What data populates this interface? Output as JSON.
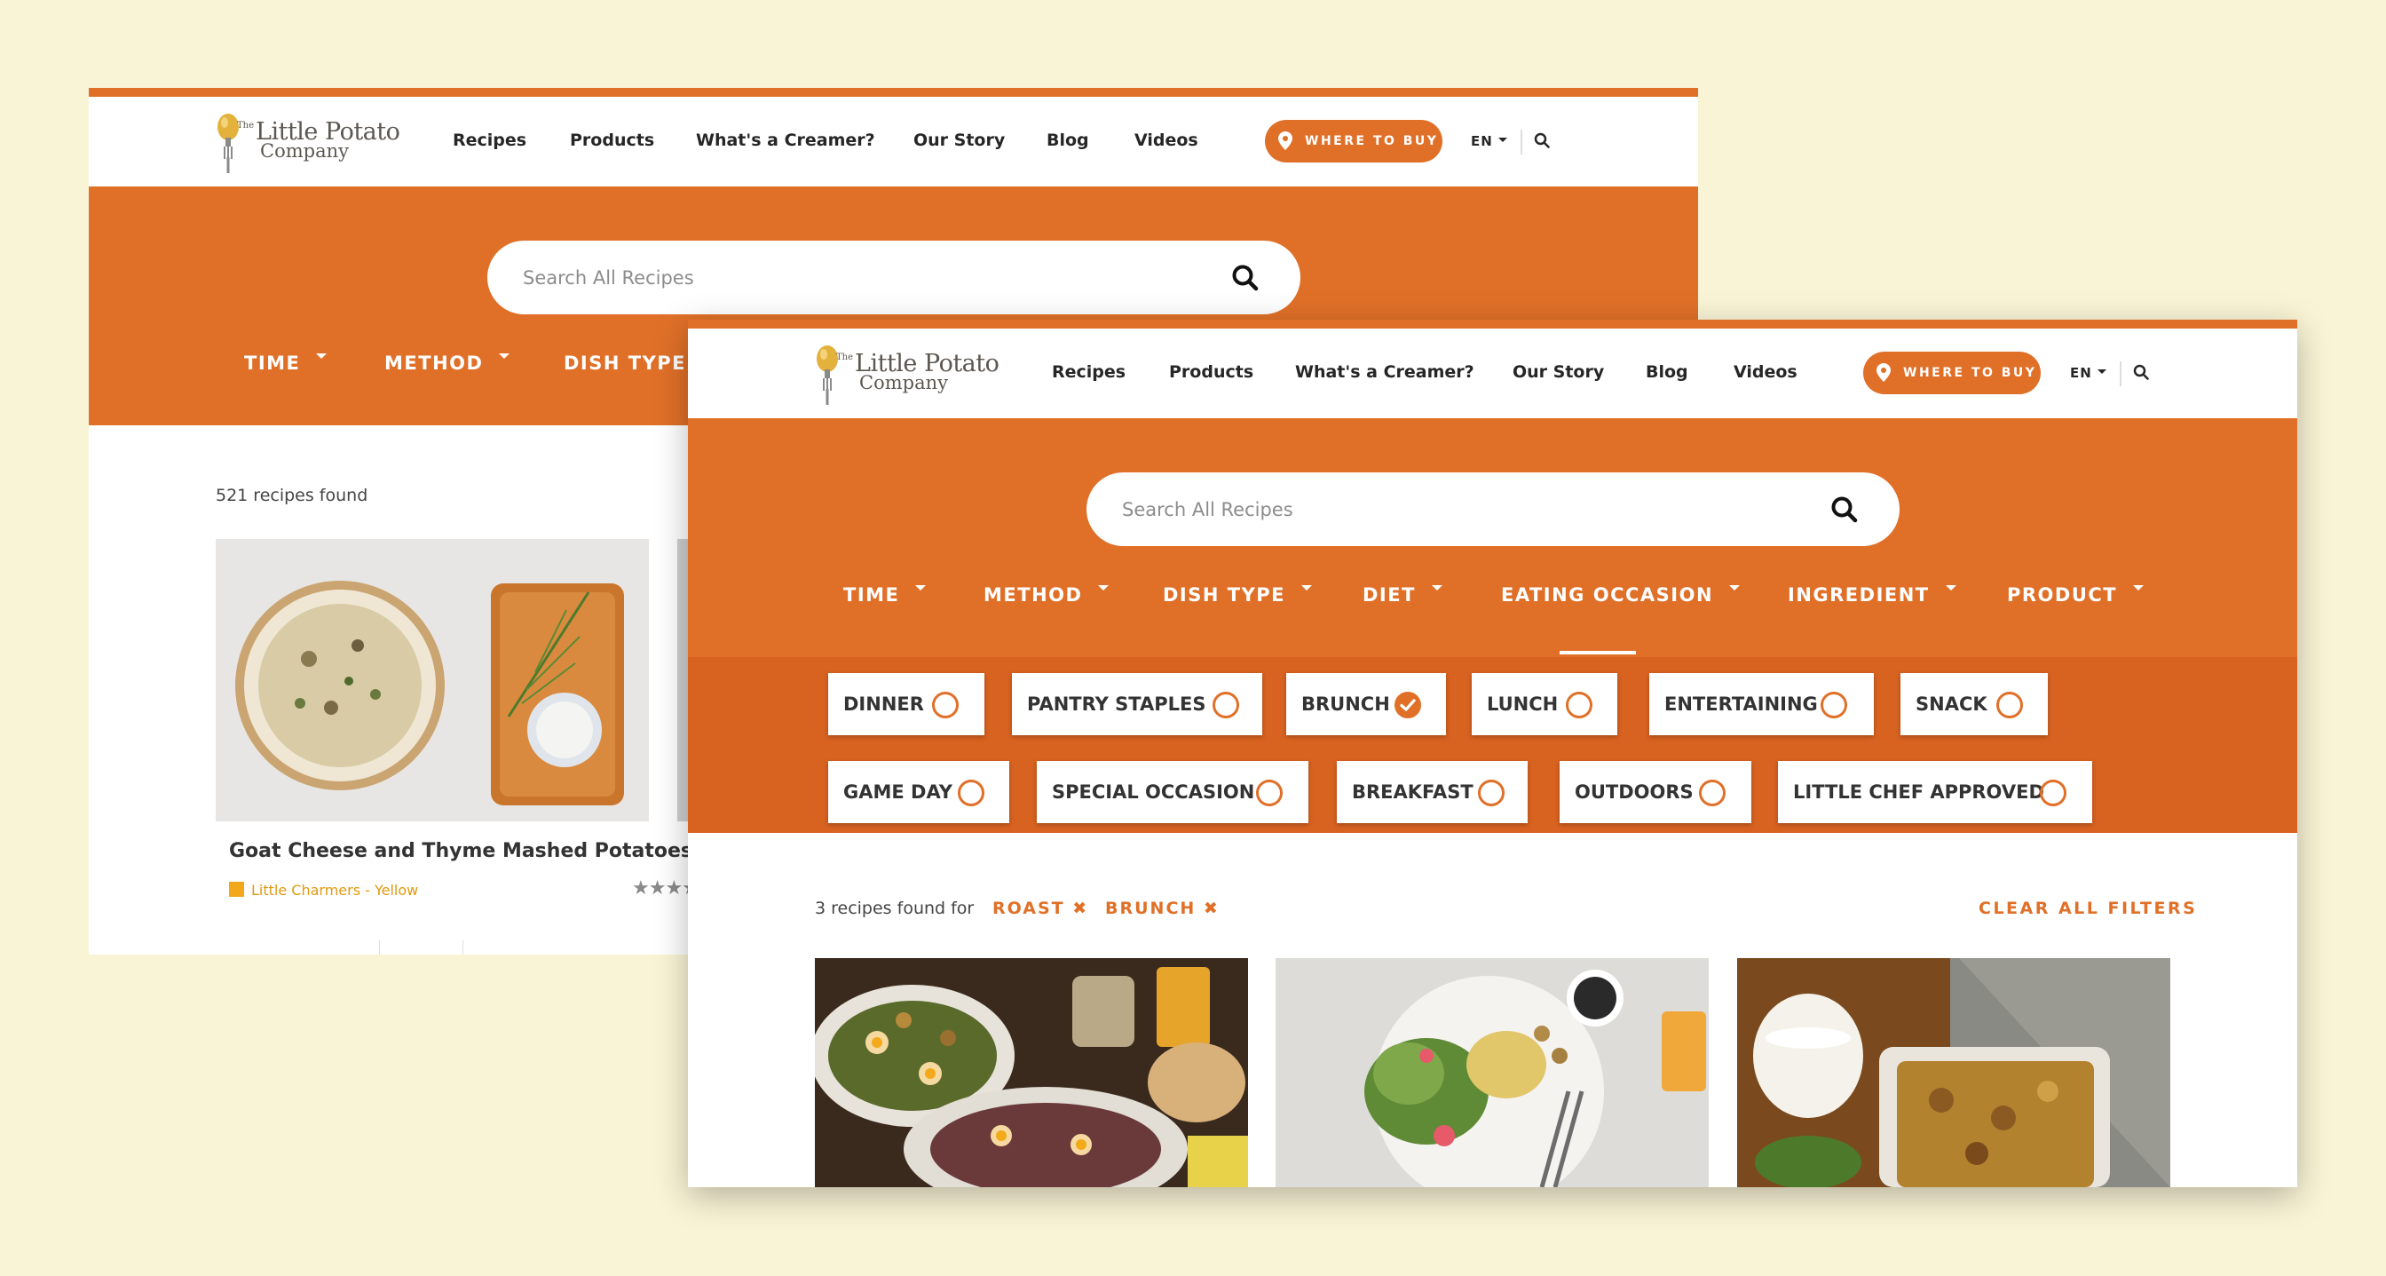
{
  "brand": {
    "name_small": "The",
    "name_main": "Little Potato",
    "name_sub": "Company"
  },
  "nav": {
    "items": [
      "Recipes",
      "Products",
      "What's a Creamer?",
      "Our Story",
      "Blog",
      "Videos"
    ],
    "where_to_buy": "WHERE TO BUY",
    "language": "EN"
  },
  "search": {
    "placeholder": "Search All Recipes"
  },
  "back_window": {
    "filters": [
      "TIME",
      "METHOD",
      "DISH TYPE"
    ],
    "results_count": "521 recipes found",
    "card": {
      "title": "Goat Cheese and Thyme Mashed Potatoes",
      "product": "Little Charmers - Yellow",
      "rating_stars": 5
    }
  },
  "front_window": {
    "filters": [
      "TIME",
      "METHOD",
      "DISH TYPE",
      "DIET",
      "EATING OCCASION",
      "INGREDIENT",
      "PRODUCT"
    ],
    "active_filter": "EATING OCCASION",
    "occasion_options": [
      {
        "label": "DINNER",
        "checked": false
      },
      {
        "label": "PANTRY STAPLES",
        "checked": false
      },
      {
        "label": "BRUNCH",
        "checked": true
      },
      {
        "label": "LUNCH",
        "checked": false
      },
      {
        "label": "ENTERTAINING",
        "checked": false
      },
      {
        "label": "SNACK",
        "checked": false
      },
      {
        "label": "GAME DAY",
        "checked": false
      },
      {
        "label": "SPECIAL OCCASION",
        "checked": false
      },
      {
        "label": "BREAKFAST",
        "checked": false
      },
      {
        "label": "OUTDOORS",
        "checked": false
      },
      {
        "label": "LITTLE CHEF APPROVED",
        "checked": false
      }
    ],
    "results_prefix": "3 recipes found for",
    "applied_tags": [
      "ROAST ✖",
      "BRUNCH ✖"
    ],
    "clear_all": "CLEAR ALL FILTERS"
  },
  "colors": {
    "accent": "#e07028",
    "accent_dark": "#d86220",
    "background": "#faf4d6",
    "rating_tag": "#f2a81a"
  },
  "icons": [
    "potato-fork-logo-icon",
    "map-pin-icon",
    "caret-down-icon",
    "search-icon",
    "radio-circle-icon",
    "check-icon",
    "star-icon"
  ]
}
